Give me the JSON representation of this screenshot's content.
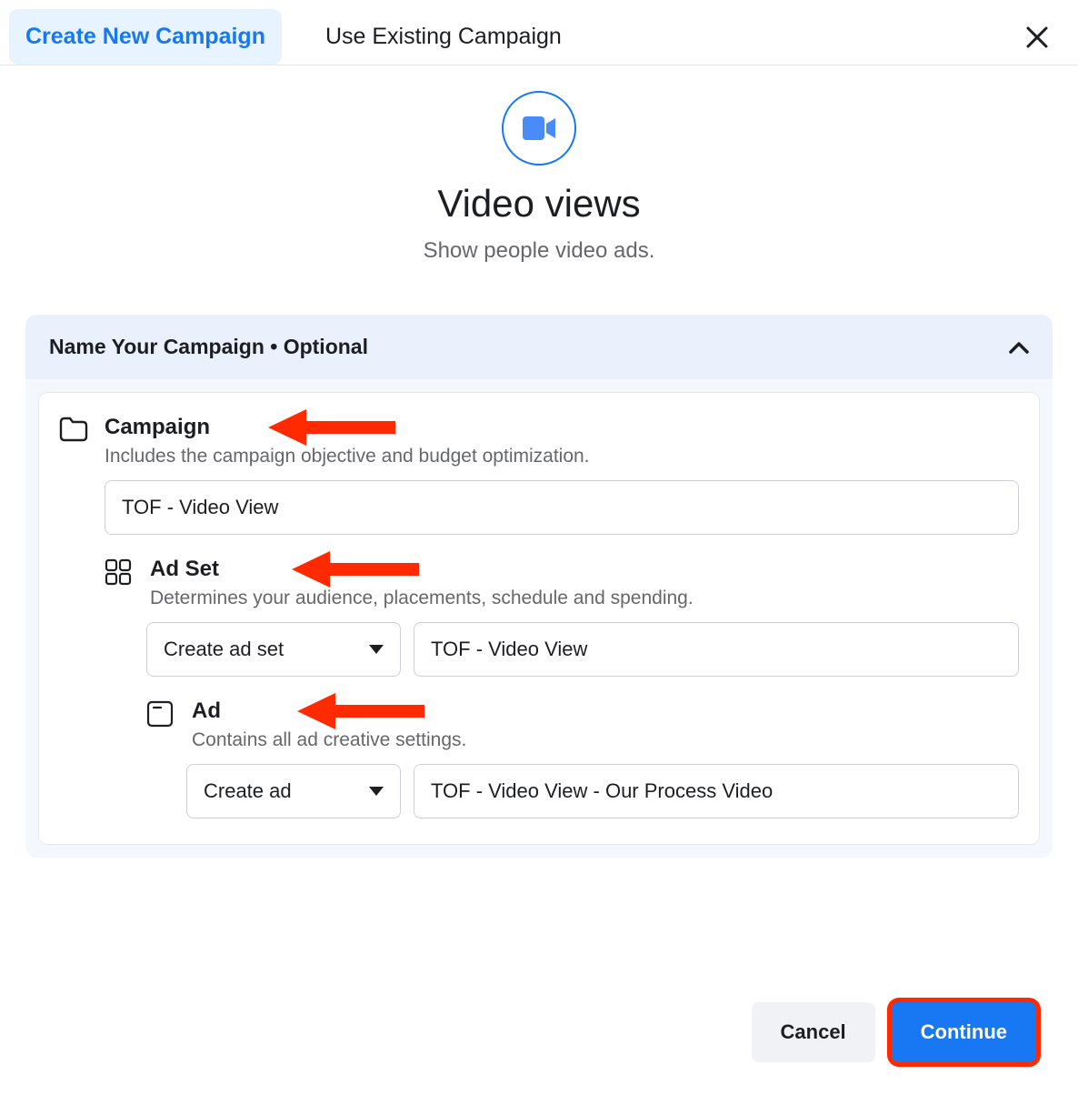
{
  "tabs": {
    "create": "Create New Campaign",
    "existing": "Use Existing Campaign"
  },
  "hero": {
    "title": "Video views",
    "subtitle": "Show people video ads."
  },
  "panel": {
    "header": "Name Your Campaign • Optional"
  },
  "campaign": {
    "title": "Campaign",
    "desc": "Includes the campaign objective and budget optimization.",
    "value": "TOF - Video View"
  },
  "adset": {
    "title": "Ad Set",
    "desc": "Determines your audience, placements, schedule and spending.",
    "select_label": "Create ad set",
    "value": "TOF - Video View"
  },
  "ad": {
    "title": "Ad",
    "desc": "Contains all ad creative settings.",
    "select_label": "Create ad",
    "value": "TOF - Video View - Our Process Video"
  },
  "footer": {
    "cancel": "Cancel",
    "continue": "Continue"
  }
}
